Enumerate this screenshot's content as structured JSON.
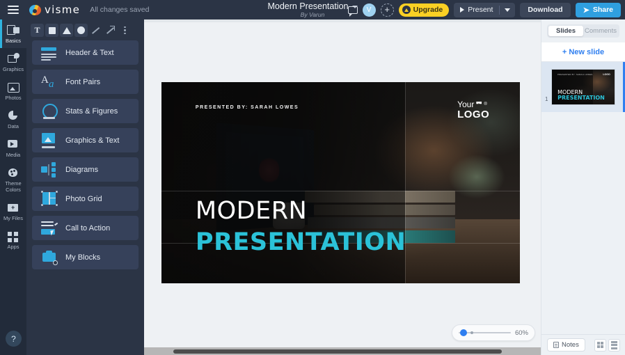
{
  "topbar": {
    "menu_icon": "hamburger-icon",
    "brand": "visme",
    "save_status": "All changes saved",
    "doc_title": "Modern Presentation",
    "doc_author": "By Varun",
    "comments_icon": "comment-icon",
    "avatar_initial": "V",
    "add_people_icon": "add-person-icon",
    "upgrade_label": "Upgrade",
    "present_label": "Present",
    "download_label": "Download",
    "share_label": "Share"
  },
  "rail": {
    "items": [
      {
        "label": "Basics",
        "icon": "basics-icon",
        "active": true
      },
      {
        "label": "Graphics",
        "icon": "graphics-icon",
        "active": false
      },
      {
        "label": "Photos",
        "icon": "photos-icon",
        "active": false
      },
      {
        "label": "Data",
        "icon": "data-icon",
        "active": false
      },
      {
        "label": "Media",
        "icon": "media-icon",
        "active": false
      },
      {
        "label": "Theme Colors",
        "label_1": "Theme",
        "label_2": "Colors",
        "icon": "theme-colors-icon",
        "active": false
      },
      {
        "label": "My Files",
        "icon": "my-files-icon",
        "active": false
      },
      {
        "label": "Apps",
        "icon": "apps-icon",
        "active": false
      }
    ],
    "help_label": "?"
  },
  "tools": [
    {
      "name": "text-tool",
      "glyph": "T"
    },
    {
      "name": "square-tool",
      "glyph": "square"
    },
    {
      "name": "triangle-tool",
      "glyph": "triangle"
    },
    {
      "name": "circle-tool",
      "glyph": "circle"
    },
    {
      "name": "line-tool",
      "glyph": "line"
    },
    {
      "name": "arrow-tool",
      "glyph": "arrow"
    },
    {
      "name": "more-tools",
      "glyph": "vertical-dots"
    }
  ],
  "blocks": [
    {
      "label": "Header & Text",
      "icon": "header-text-icon"
    },
    {
      "label": "Font Pairs",
      "icon": "font-pairs-icon"
    },
    {
      "label": "Stats & Figures",
      "icon": "stats-figures-icon"
    },
    {
      "label": "Graphics & Text",
      "icon": "graphics-text-icon"
    },
    {
      "label": "Diagrams",
      "icon": "diagrams-icon"
    },
    {
      "label": "Photo Grid",
      "icon": "photo-grid-icon"
    },
    {
      "label": "Call to Action",
      "icon": "call-to-action-icon"
    },
    {
      "label": "My Blocks",
      "icon": "my-blocks-icon"
    }
  ],
  "slide": {
    "presented_by": "PRESENTED BY: SARAH LOWES",
    "logo_line1": "Your",
    "logo_line2": "LOGO",
    "logo_registered": "®",
    "title_line1": "MODERN",
    "title_line2": "PRESENTATION",
    "accent_color": "#2bc2d8"
  },
  "zoom": {
    "value_label": "60%",
    "value": 60
  },
  "right_panel": {
    "tab_slides": "Slides",
    "tab_comments": "Comments",
    "active_tab": "Slides",
    "new_slide_label": "+ New slide",
    "slides": [
      {
        "number": "1",
        "title1": "MODERN",
        "title2": "PRESENTATION",
        "presented_by": "PRESENTED BY: SARAH LOWES",
        "logo": "LOGO"
      }
    ],
    "notes_label": "Notes",
    "view_grid_icon": "grid-view-icon",
    "view_list_icon": "list-view-icon"
  }
}
